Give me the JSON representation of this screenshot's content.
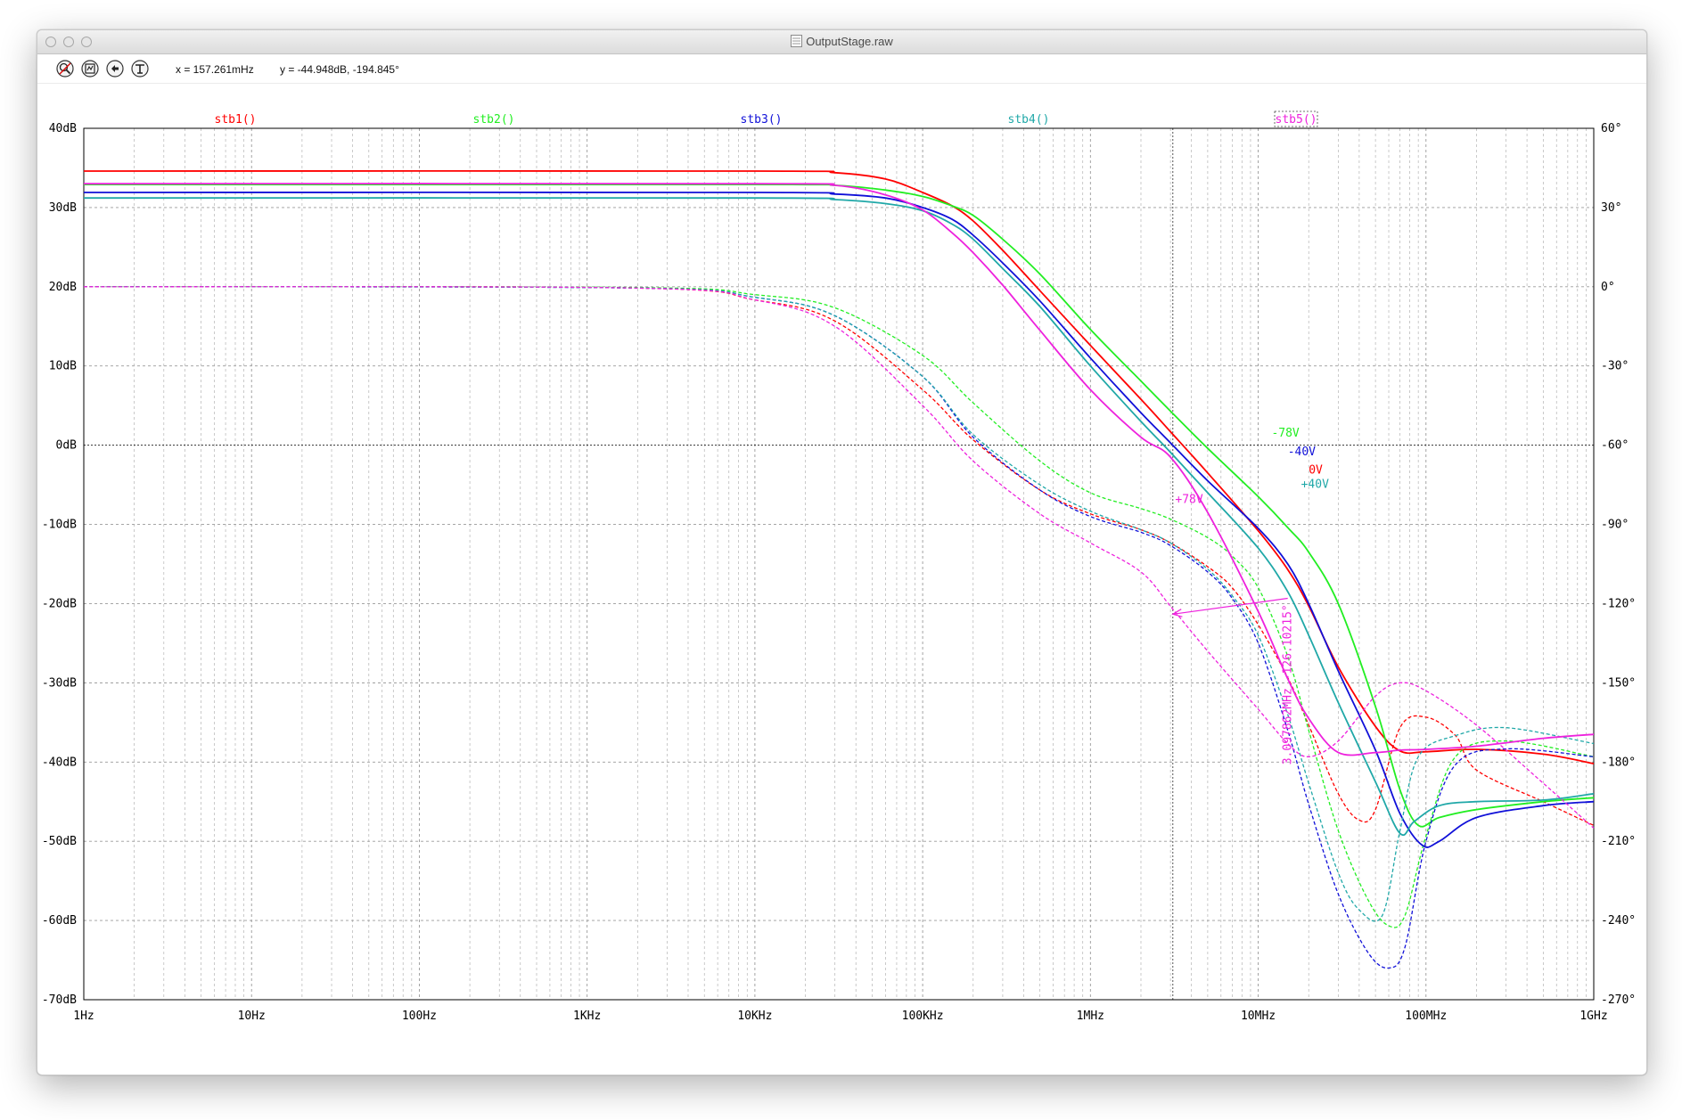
{
  "window": {
    "title": "OutputStage.raw",
    "cursor_x": "x = 157.261mHz",
    "cursor_y": "y = -44.948dB, -194.845°"
  },
  "toolbar": {
    "icons": [
      "zoom-to-fit-icon",
      "autoscale-y-icon",
      "zoom-back-icon",
      "cursor-tool-icon"
    ]
  },
  "colors": {
    "stb1": "#ff0000",
    "stb2": "#22ee22",
    "stb3": "#1010d8",
    "stb4": "#20a8a8",
    "stb5": "#ee22dd",
    "grid": "#9a9a9a",
    "axis": "#000000"
  },
  "chart_data": {
    "type": "line",
    "x_scale": "log",
    "x_range_hz": [
      1,
      1000000000
    ],
    "x_ticks": [
      {
        "v": 1,
        "label": "1Hz"
      },
      {
        "v": 10,
        "label": "10Hz"
      },
      {
        "v": 100,
        "label": "100Hz"
      },
      {
        "v": 1000,
        "label": "1KHz"
      },
      {
        "v": 10000,
        "label": "10KHz"
      },
      {
        "v": 100000,
        "label": "100KHz"
      },
      {
        "v": 1000000,
        "label": "1MHz"
      },
      {
        "v": 10000000,
        "label": "10MHz"
      },
      {
        "v": 100000000,
        "label": "100MHz"
      },
      {
        "v": 1000000000,
        "label": "1GHz"
      }
    ],
    "y_left_range_db": [
      -70,
      40
    ],
    "y_left_ticks": [
      {
        "v": 40,
        "label": "40dB"
      },
      {
        "v": 30,
        "label": "30dB"
      },
      {
        "v": 20,
        "label": "20dB"
      },
      {
        "v": 10,
        "label": "10dB"
      },
      {
        "v": 0,
        "label": "0dB"
      },
      {
        "v": -10,
        "label": "-10dB"
      },
      {
        "v": -20,
        "label": "-20dB"
      },
      {
        "v": -30,
        "label": "-30dB"
      },
      {
        "v": -40,
        "label": "-40dB"
      },
      {
        "v": -50,
        "label": "-50dB"
      },
      {
        "v": -60,
        "label": "-60dB"
      },
      {
        "v": -70,
        "label": "-70dB"
      }
    ],
    "y_right_range_deg": [
      -270,
      60
    ],
    "y_right_ticks": [
      {
        "v": 60,
        "label": "60°"
      },
      {
        "v": 30,
        "label": "30°"
      },
      {
        "v": 0,
        "label": "0°"
      },
      {
        "v": -30,
        "label": "-30°"
      },
      {
        "v": -60,
        "label": "-60°"
      },
      {
        "v": -90,
        "label": "-90°"
      },
      {
        "v": -120,
        "label": "-120°"
      },
      {
        "v": -150,
        "label": "-150°"
      },
      {
        "v": -180,
        "label": "-180°"
      },
      {
        "v": -210,
        "label": "-210°"
      },
      {
        "v": -240,
        "label": "-240°"
      },
      {
        "v": -270,
        "label": "-270°"
      }
    ],
    "grid": true,
    "legend": "top",
    "series": [
      {
        "name": "stb1()",
        "color_key": "stb1",
        "annotation": "0V",
        "gain_db": [
          [
            1,
            34.6
          ],
          [
            10000,
            34.6
          ],
          [
            30000,
            34.4
          ],
          [
            60000,
            33.6
          ],
          [
            100000,
            31.9
          ],
          [
            150000,
            30.2
          ],
          [
            200000,
            28.3
          ],
          [
            300000,
            24.6
          ],
          [
            500000,
            19.5
          ],
          [
            1000000,
            12.6
          ],
          [
            2000000,
            5.8
          ],
          [
            3000000,
            1.7
          ],
          [
            5000000,
            -3.5
          ],
          [
            10000000,
            -10.8
          ],
          [
            15000000,
            -15.7
          ],
          [
            20000000,
            -20.3
          ],
          [
            30000000,
            -28
          ],
          [
            50000000,
            -35.5
          ],
          [
            70000000,
            -38.6
          ],
          [
            100000000,
            -38.7
          ],
          [
            200000000,
            -38.4
          ],
          [
            500000000,
            -39
          ],
          [
            1000000000,
            -40.2
          ]
        ],
        "phase_deg": [
          [
            1,
            0
          ],
          [
            2000,
            -0.5
          ],
          [
            10000,
            -5
          ],
          [
            30000,
            -13
          ],
          [
            100000,
            -39
          ],
          [
            200000,
            -58
          ],
          [
            500000,
            -77
          ],
          [
            1000000,
            -86
          ],
          [
            2000000,
            -92
          ],
          [
            3000000,
            -97
          ],
          [
            5000000,
            -106
          ],
          [
            7000000,
            -114
          ],
          [
            10000000,
            -128
          ],
          [
            15000000,
            -148
          ],
          [
            20000000,
            -166
          ],
          [
            30000000,
            -192
          ],
          [
            40000000,
            -202
          ],
          [
            50000000,
            -198
          ],
          [
            70000000,
            -167
          ],
          [
            100000000,
            -163
          ],
          [
            150000000,
            -170
          ],
          [
            200000000,
            -183
          ],
          [
            500000000,
            -195
          ],
          [
            1000000000,
            -204
          ]
        ]
      },
      {
        "name": "stb2()",
        "color_key": "stb2",
        "annotation": "-78V",
        "gain_db": [
          [
            1,
            32.9
          ],
          [
            10000,
            32.9
          ],
          [
            30000,
            32.8
          ],
          [
            60000,
            32.2
          ],
          [
            100000,
            31.4
          ],
          [
            150000,
            30.2
          ],
          [
            200000,
            29
          ],
          [
            300000,
            26
          ],
          [
            500000,
            21.6
          ],
          [
            1000000,
            14.6
          ],
          [
            2000000,
            8.1
          ],
          [
            3000000,
            4.3
          ],
          [
            5000000,
            -0.4
          ],
          [
            10000000,
            -6.5
          ],
          [
            15000000,
            -10.4
          ],
          [
            20000000,
            -13.5
          ],
          [
            30000000,
            -20
          ],
          [
            50000000,
            -33
          ],
          [
            70000000,
            -43.5
          ],
          [
            90000000,
            -48
          ],
          [
            120000000,
            -47
          ],
          [
            200000000,
            -46
          ],
          [
            500000000,
            -45
          ],
          [
            1000000000,
            -44.5
          ]
        ],
        "phase_deg": [
          [
            1,
            0
          ],
          [
            2000,
            -0.3
          ],
          [
            10000,
            -3
          ],
          [
            30000,
            -8
          ],
          [
            100000,
            -26
          ],
          [
            200000,
            -44
          ],
          [
            500000,
            -66
          ],
          [
            1000000,
            -78
          ],
          [
            2000000,
            -84
          ],
          [
            3000000,
            -88
          ],
          [
            5000000,
            -95
          ],
          [
            7000000,
            -102
          ],
          [
            10000000,
            -114
          ],
          [
            15000000,
            -140
          ],
          [
            20000000,
            -168
          ],
          [
            30000000,
            -206
          ],
          [
            45000000,
            -232
          ],
          [
            60000000,
            -242
          ],
          [
            75000000,
            -238
          ],
          [
            100000000,
            -208
          ],
          [
            150000000,
            -178
          ],
          [
            300000000,
            -172
          ],
          [
            1000000000,
            -178
          ]
        ]
      },
      {
        "name": "stb3()",
        "color_key": "stb3",
        "annotation": "-40V",
        "gain_db": [
          [
            1,
            31.9
          ],
          [
            10000,
            31.9
          ],
          [
            30000,
            31.7
          ],
          [
            60000,
            31.2
          ],
          [
            100000,
            30
          ],
          [
            150000,
            28.5
          ],
          [
            200000,
            26.5
          ],
          [
            300000,
            23
          ],
          [
            500000,
            18.2
          ],
          [
            1000000,
            11
          ],
          [
            2000000,
            4.1
          ],
          [
            3000000,
            0.3
          ],
          [
            5000000,
            -4.5
          ],
          [
            10000000,
            -10.5
          ],
          [
            15000000,
            -15
          ],
          [
            20000000,
            -20
          ],
          [
            30000000,
            -28.5
          ],
          [
            50000000,
            -38.5
          ],
          [
            70000000,
            -46.5
          ],
          [
            95000000,
            -50.5
          ],
          [
            120000000,
            -50
          ],
          [
            200000000,
            -47
          ],
          [
            500000000,
            -45.5
          ],
          [
            1000000000,
            -45
          ]
        ],
        "phase_deg": [
          [
            1,
            0
          ],
          [
            2000,
            -0.5
          ],
          [
            10000,
            -4
          ],
          [
            30000,
            -11
          ],
          [
            100000,
            -34
          ],
          [
            200000,
            -57
          ],
          [
            500000,
            -77
          ],
          [
            1000000,
            -87
          ],
          [
            2000000,
            -93
          ],
          [
            3000000,
            -98
          ],
          [
            5000000,
            -108
          ],
          [
            7000000,
            -118
          ],
          [
            10000000,
            -135
          ],
          [
            15000000,
            -168
          ],
          [
            20000000,
            -196
          ],
          [
            30000000,
            -230
          ],
          [
            45000000,
            -252
          ],
          [
            60000000,
            -258
          ],
          [
            75000000,
            -250
          ],
          [
            100000000,
            -210
          ],
          [
            150000000,
            -181
          ],
          [
            300000000,
            -175
          ],
          [
            1000000000,
            -178
          ]
        ]
      },
      {
        "name": "stb4()",
        "color_key": "stb4",
        "annotation": "+40V",
        "gain_db": [
          [
            1,
            31.2
          ],
          [
            10000,
            31.2
          ],
          [
            30000,
            31
          ],
          [
            60000,
            30.5
          ],
          [
            100000,
            29.6
          ],
          [
            150000,
            27.9
          ],
          [
            200000,
            26
          ],
          [
            300000,
            22.3
          ],
          [
            500000,
            17.5
          ],
          [
            1000000,
            10
          ],
          [
            2000000,
            3
          ],
          [
            3000000,
            -0.9
          ],
          [
            5000000,
            -6
          ],
          [
            10000000,
            -13
          ],
          [
            15000000,
            -18.5
          ],
          [
            20000000,
            -24
          ],
          [
            30000000,
            -32.5
          ],
          [
            50000000,
            -42.5
          ],
          [
            70000000,
            -49
          ],
          [
            85000000,
            -47.5
          ],
          [
            120000000,
            -45.5
          ],
          [
            200000000,
            -45
          ],
          [
            500000000,
            -44.8
          ],
          [
            1000000000,
            -44
          ]
        ],
        "phase_deg": [
          [
            1,
            0
          ],
          [
            2000,
            -0.5
          ],
          [
            10000,
            -4
          ],
          [
            30000,
            -11
          ],
          [
            100000,
            -34
          ],
          [
            200000,
            -56
          ],
          [
            500000,
            -75
          ],
          [
            1000000,
            -85
          ],
          [
            2000000,
            -92
          ],
          [
            3000000,
            -97
          ],
          [
            5000000,
            -107
          ],
          [
            7000000,
            -117
          ],
          [
            10000000,
            -132
          ],
          [
            15000000,
            -162
          ],
          [
            20000000,
            -188
          ],
          [
            30000000,
            -222
          ],
          [
            40000000,
            -236
          ],
          [
            55000000,
            -238
          ],
          [
            70000000,
            -206
          ],
          [
            90000000,
            -178
          ],
          [
            150000000,
            -170
          ],
          [
            300000000,
            -167
          ],
          [
            1000000000,
            -173
          ]
        ]
      },
      {
        "name": "stb5()",
        "color_key": "stb5",
        "annotation": "+78V",
        "gain_db": [
          [
            1,
            33
          ],
          [
            10000,
            33
          ],
          [
            30000,
            32.8
          ],
          [
            60000,
            31.6
          ],
          [
            100000,
            29.7
          ],
          [
            150000,
            26.8
          ],
          [
            200000,
            24.3
          ],
          [
            300000,
            20.2
          ],
          [
            500000,
            14.5
          ],
          [
            1000000,
            7
          ],
          [
            2000000,
            1
          ],
          [
            3000000,
            -1.5
          ],
          [
            5000000,
            -8.5
          ],
          [
            10000000,
            -21
          ],
          [
            15000000,
            -29.5
          ],
          [
            20000000,
            -34.5
          ],
          [
            30000000,
            -38.8
          ],
          [
            50000000,
            -38.8
          ],
          [
            70000000,
            -38.5
          ],
          [
            100000000,
            -38.4
          ],
          [
            200000000,
            -38
          ],
          [
            500000000,
            -37
          ],
          [
            1000000000,
            -36.5
          ]
        ],
        "phase_deg": [
          [
            1,
            0
          ],
          [
            2000,
            -0.5
          ],
          [
            10000,
            -5
          ],
          [
            30000,
            -15
          ],
          [
            100000,
            -45
          ],
          [
            200000,
            -66
          ],
          [
            500000,
            -86
          ],
          [
            1000000,
            -97
          ],
          [
            2000000,
            -108
          ],
          [
            3000000,
            -121
          ],
          [
            5000000,
            -138
          ],
          [
            10000000,
            -160
          ],
          [
            15000000,
            -173
          ],
          [
            20000000,
            -178
          ],
          [
            30000000,
            -172
          ],
          [
            50000000,
            -155
          ],
          [
            70000000,
            -150
          ],
          [
            100000000,
            -153
          ],
          [
            200000000,
            -166
          ],
          [
            500000000,
            -188
          ],
          [
            1000000000,
            -205
          ]
        ]
      }
    ],
    "cursor": {
      "x_hz": 3097862,
      "annotation": "3.097862MHz  -126.10215°",
      "arrow_from": {
        "x_hz": 3097862,
        "phase_deg": -124
      },
      "arrow_to": {
        "x_hz": 15000000,
        "phase_deg": -118
      }
    },
    "annotations": [
      {
        "text": "-78V",
        "color_key": "stb2",
        "x_hz": 12000000,
        "y_db": 1.1
      },
      {
        "text": "-40V",
        "color_key": "stb3",
        "x_hz": 15000000,
        "y_db": -1.3
      },
      {
        "text": "0V",
        "color_key": "stb1",
        "x_hz": 20000000,
        "y_db": -3.6
      },
      {
        "text": "+40V",
        "color_key": "stb4",
        "x_hz": 18000000,
        "y_db": -5.4
      },
      {
        "text": "+78V",
        "color_key": "stb5",
        "x_hz": 3200000,
        "y_db": -7.3
      }
    ]
  }
}
